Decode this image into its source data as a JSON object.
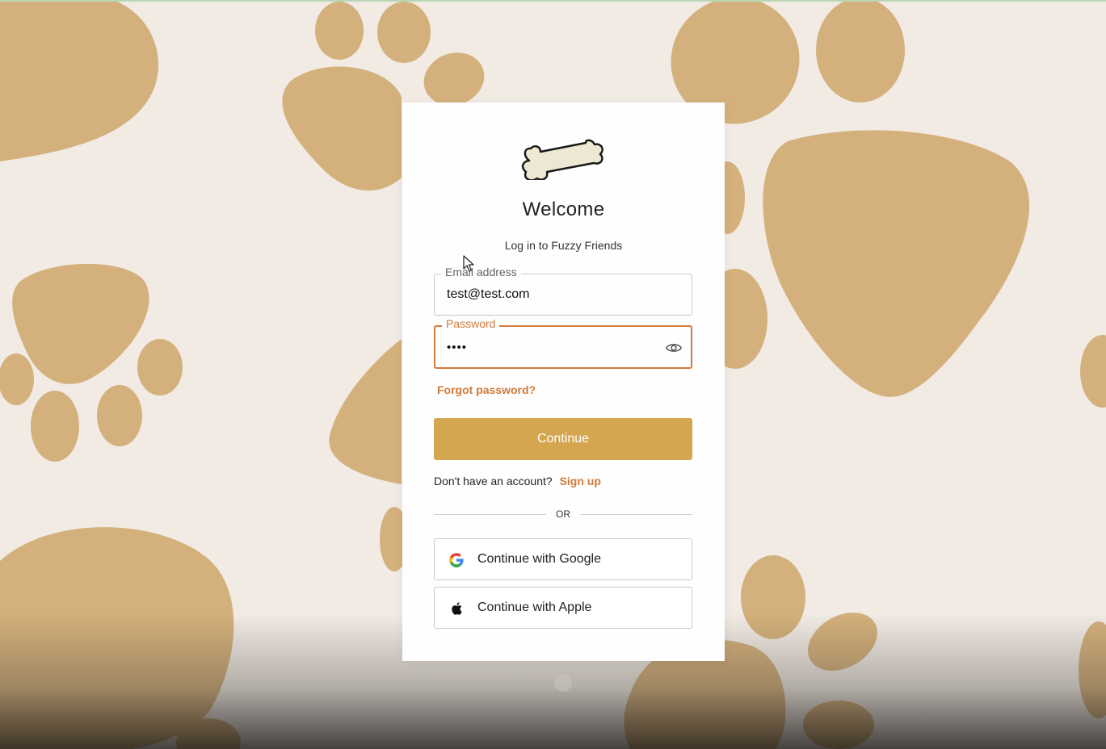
{
  "app": {
    "name": "Fuzzy Friends"
  },
  "login": {
    "title": "Welcome",
    "subtitle": "Log in to Fuzzy Friends",
    "email": {
      "label": "Email address",
      "value": "test@test.com"
    },
    "password": {
      "label": "Password",
      "value": "••••"
    },
    "forgot_label": "Forgot password?",
    "continue_label": "Continue",
    "no_account_text": "Don't have an account?",
    "signup_label": "Sign up",
    "or_text": "OR",
    "google_label": "Continue with Google",
    "apple_label": "Continue with Apple"
  },
  "colors": {
    "accent": "#d5a650",
    "link": "#d07a3a",
    "paw": "#d4b07c",
    "background": "#f1ebe4"
  },
  "icons": {
    "logo": "bone-logo-icon",
    "password_toggle": "eye-icon",
    "google": "google-icon",
    "apple": "apple-icon",
    "cursor": "mouse-cursor-icon"
  }
}
